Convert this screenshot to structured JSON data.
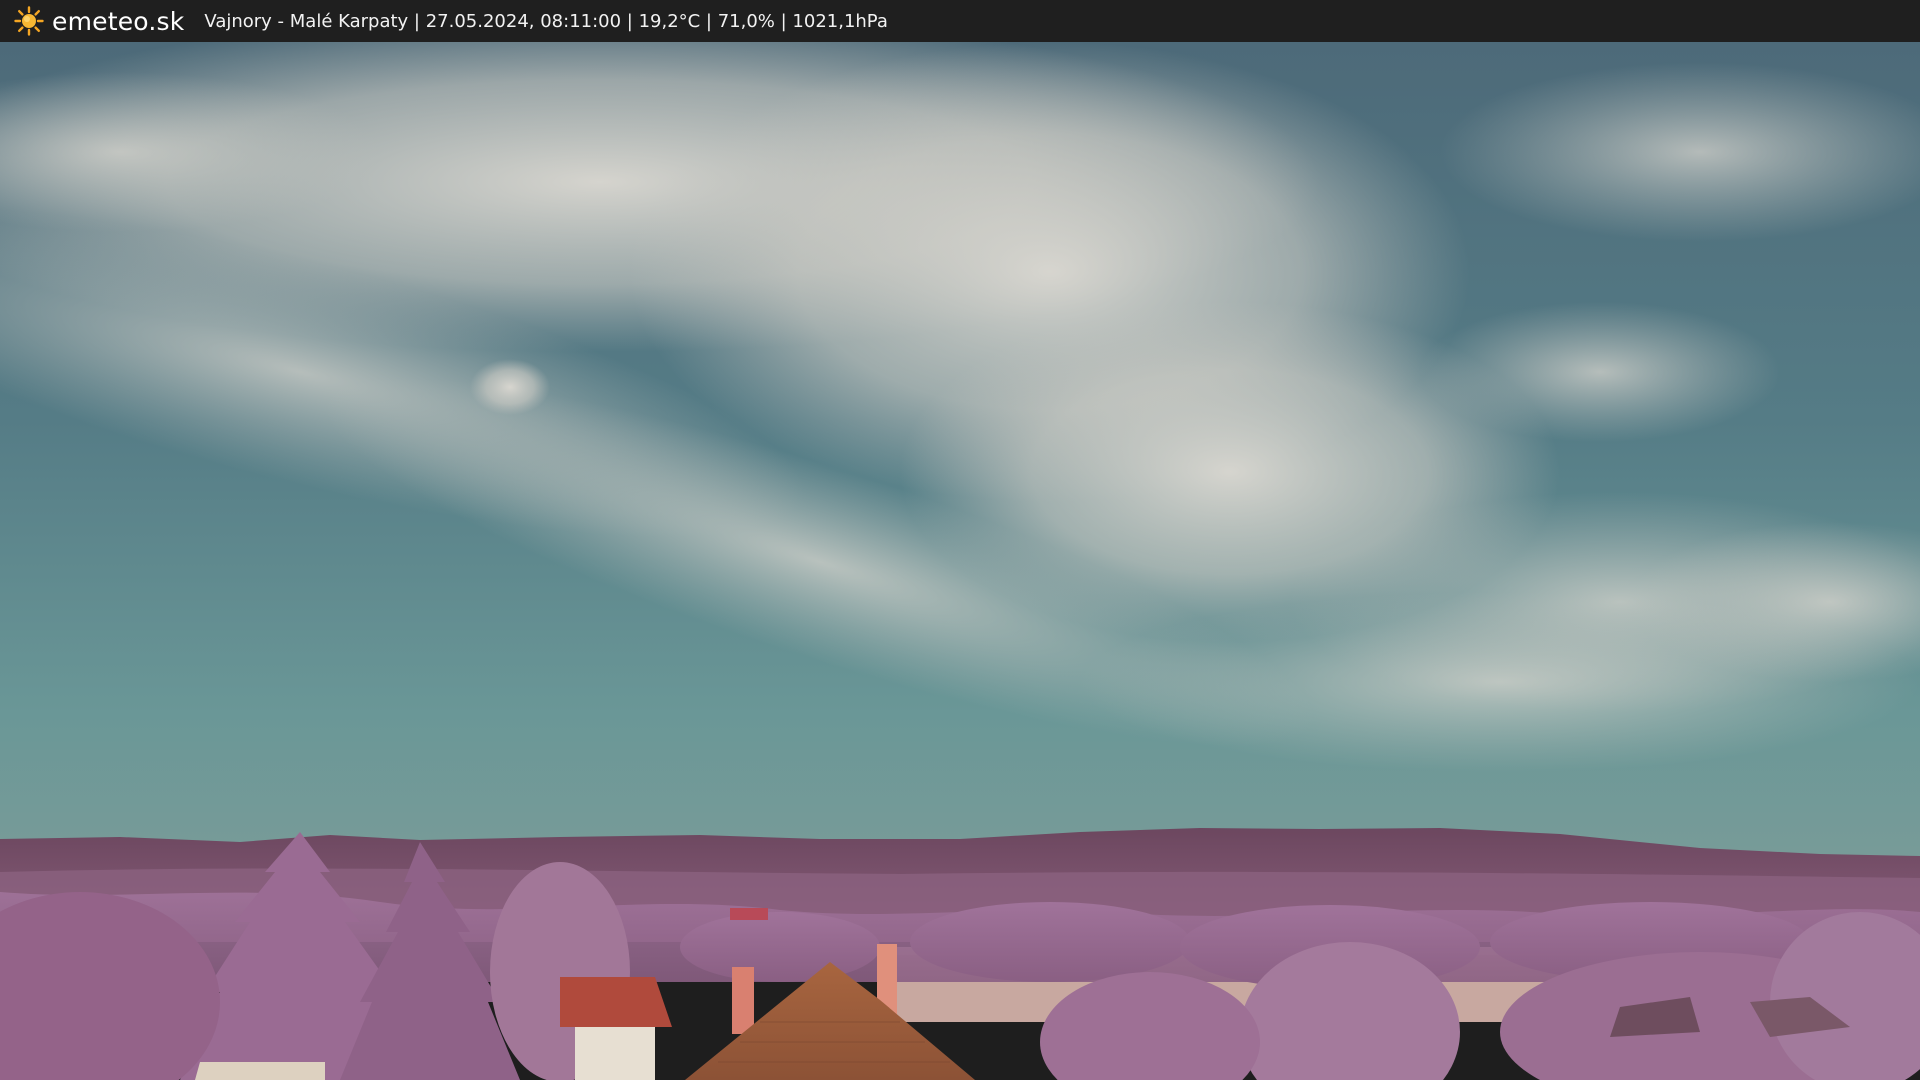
{
  "header": {
    "logo_icon": "sun-icon",
    "brand": "emeteo.sk",
    "caption": "Vajnory - Malé Karpaty | 27.05.2024, 08:11:00 | 19,2°C | 71,0% | 1021,1hPa"
  },
  "colors": {
    "bar_background": "#1f1f1f",
    "sun": "#f5a623",
    "sky_top": "#4f6e7c",
    "sky_bottom": "#5f8e90",
    "cloud": "#d4d2cc",
    "foliage": "#9a6a8e",
    "hills": "#6e4a62",
    "roof": "#a5643f",
    "field": "#c9a9a2"
  }
}
